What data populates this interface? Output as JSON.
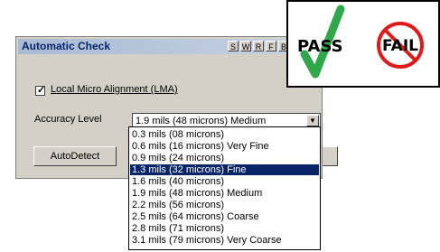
{
  "window": {
    "title": "Automatic Check",
    "title_buttons": [
      "S",
      "W",
      "R",
      "F",
      "B"
    ]
  },
  "lma": {
    "checked": true,
    "label": "Local Micro Alignment (LMA)"
  },
  "accuracy": {
    "label": "Accuracy Level",
    "selected": "1.9 mils (48 microns) Medium"
  },
  "autodetect_label": "AutoDetect",
  "dropdown": {
    "options": [
      "0.3 mils (08 microns)",
      "0.6 mils (16 microns) Very Fine",
      "0.9 mils (24 microns)",
      "1.3 mils (32 microns) Fine",
      "1.6 mils (40 microns)",
      "1.9 mils (48 microns) Medium",
      "2.2 mils (56 microns)",
      "2.5 mils (64 microns) Coarse",
      "2.8 mils (71 microns)",
      "3.1 mils (79 microns) Very Coarse"
    ],
    "highlighted": "1.3 mils (32 microns) Fine"
  },
  "badge": {
    "pass": "PASS",
    "fail": "FAIL"
  },
  "colors": {
    "title_text": "#0a246a",
    "selection": "#0a246a",
    "check_green": "#2ea84a",
    "no_red": "#e01a1a"
  }
}
